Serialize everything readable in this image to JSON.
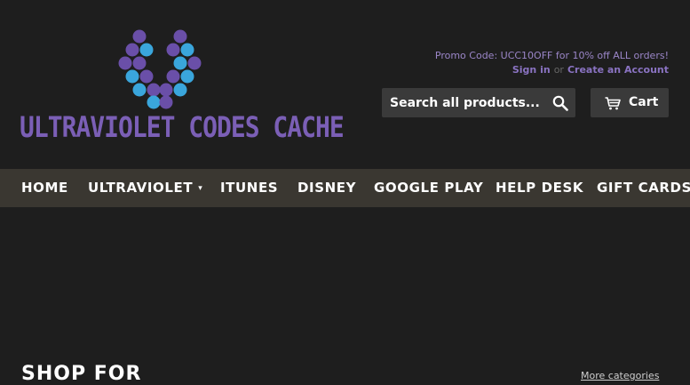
{
  "colors": {
    "background": "#1e1e1e",
    "nav_bg": "#3a3731",
    "dot_purple": "#6a4fa8",
    "dot_blue": "#3aa6dc",
    "logo_text": "#7b5fb6",
    "button_bg": "#3a3a3a"
  },
  "header": {
    "logo_text": "ULTRAVIOLET CODES CACHE",
    "promo": "Promo Code: UCC10OFF for 10% off ALL orders!",
    "sign_in": "Sign in",
    "or": "or",
    "create_account": "Create an Account",
    "search_placeholder": "Search all products...",
    "search_icon": "search-icon",
    "cart_label": "Cart",
    "cart_icon": "cart-icon"
  },
  "nav": {
    "items": [
      {
        "label": "HOME"
      },
      {
        "label": "ULTRAVIOLET",
        "has_dropdown": true
      },
      {
        "label": "ITUNES"
      },
      {
        "label": "DISNEY"
      },
      {
        "label": "GOOGLE PLAY"
      },
      {
        "label": "HELP DESK"
      },
      {
        "label": "GIFT CARDS"
      }
    ]
  },
  "main": {
    "section_title": "SHOP FOR",
    "more_categories": "More categories"
  }
}
